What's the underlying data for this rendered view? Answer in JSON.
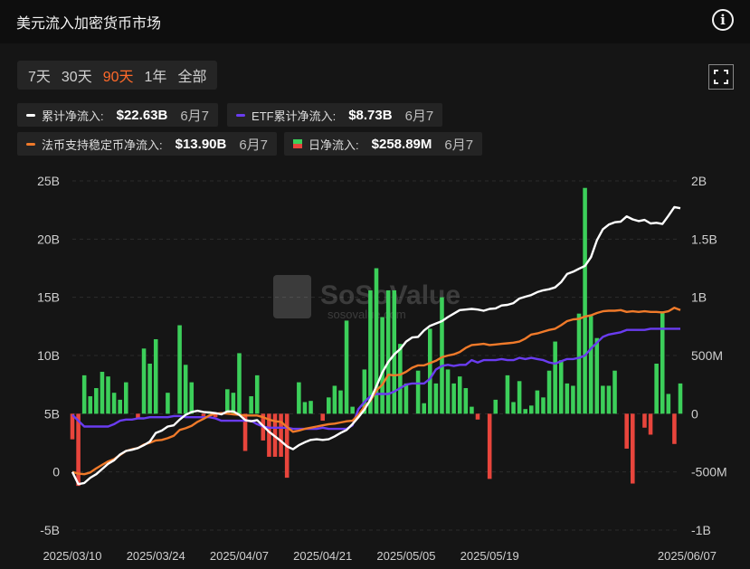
{
  "header": {
    "title": "美元流入加密货币市场"
  },
  "range_tabs": [
    "7天",
    "30天",
    "90天",
    "1年",
    "全部"
  ],
  "active_range": "90天",
  "legend": [
    {
      "label": "累计净流入:",
      "value": "$22.63B",
      "date": "6月7",
      "color": "#ffffff"
    },
    {
      "label": "ETF累计净流入:",
      "value": "$8.73B",
      "date": "6月7",
      "color": "#6a3cf0"
    },
    {
      "label": "法币支持稳定币净流入:",
      "value": "$13.90B",
      "date": "6月7",
      "color": "#f07a2a"
    },
    {
      "label": "日净流入:",
      "value": "$258.89M",
      "date": "6月7",
      "color_pos": "#3ccf5a",
      "color_neg": "#e8453c"
    }
  ],
  "watermark": {
    "brand": "SoSoValue",
    "sub": "sosovalue.com"
  },
  "chart_data": {
    "type": "bar+line",
    "x_tick_labels": [
      "2025/03/10",
      "2025/03/24",
      "2025/04/07",
      "2025/04/21",
      "2025/05/05",
      "2025/05/19",
      "2025/06/07"
    ],
    "left_axis": {
      "ticks": [
        "25B",
        "20B",
        "15B",
        "10B",
        "5B",
        "0",
        "-5B"
      ],
      "range": [
        -5,
        25
      ],
      "unit": "B"
    },
    "right_axis": {
      "ticks": [
        "2B",
        "1.5B",
        "1B",
        "500M",
        "0",
        "-500M",
        "-1B"
      ],
      "range": [
        -1,
        2
      ],
      "unit": "B"
    },
    "daily_net_inflow_B": [
      -0.22,
      -0.62,
      0.33,
      0.15,
      0.22,
      0.36,
      0.32,
      0.18,
      0.12,
      0.27,
      0,
      -0.04,
      0.56,
      0.43,
      0.64,
      0,
      0.18,
      0,
      0.76,
      0.42,
      0.27,
      0,
      -0.02,
      0.02,
      -0.03,
      0,
      0.21,
      0.18,
      0.52,
      -0.32,
      0.15,
      0.33,
      -0.23,
      -0.37,
      -0.37,
      -0.37,
      -0.55,
      0,
      0.27,
      0.1,
      0.11,
      0,
      -0.06,
      0.14,
      0.24,
      0.2,
      0.8,
      0.06,
      0,
      0.38,
      1.06,
      1.25,
      0.83,
      1.06,
      1.06,
      0.6,
      0.26,
      0,
      0.37,
      0.09,
      0.73,
      0.26,
      1,
      0.38,
      0.26,
      0.32,
      0.22,
      0.06,
      -0.05,
      0,
      -0.56,
      0.12,
      0,
      0.33,
      0.1,
      0.28,
      0.04,
      0.07,
      0.2,
      0.14,
      0.37,
      0.62,
      0.46,
      0.26,
      0.24,
      0.86,
      1.94,
      0.84,
      0.65,
      0.24,
      0.24,
      0.37,
      0,
      -0.3,
      -0.6,
      0,
      -0.12,
      -0.18,
      0.43,
      0.88,
      0.17,
      -0.26,
      0.26
    ],
    "series": [
      {
        "name": "累计净流入",
        "axis": "left",
        "values": [
          0,
          -1.05,
          -0.95,
          -0.5,
          -0.2,
          0.25,
          0.7,
          1,
          1.5,
          1.8,
          1.9,
          2.05,
          2.3,
          2.6,
          3.35,
          3.55,
          3.9,
          4,
          4.5,
          4.9,
          5.15,
          5.25,
          5.15,
          5.1,
          5.05,
          4.95,
          5.2,
          5.2,
          4.9,
          4.45,
          4.35,
          4.45,
          3.95,
          3.45,
          3.05,
          2.65,
          2.2,
          1.95,
          2.3,
          2.55,
          2.75,
          2.8,
          2.75,
          2.8,
          3.05,
          3.35,
          3.6,
          4.1,
          4.7,
          5.35,
          6.2,
          7.35,
          8.55,
          9.45,
          10.1,
          10.55,
          11.2,
          11.55,
          11.6,
          12.15,
          12.55,
          12.75,
          12.95,
          13.3,
          13.6,
          13.9,
          13.95,
          14,
          13.95,
          13.85,
          14,
          14.05,
          14.3,
          14.35,
          14.5,
          14.9,
          15.05,
          15.2,
          15.45,
          15.6,
          15.7,
          15.85,
          16.3,
          17,
          17.2,
          17.45,
          17.7,
          18.45,
          19.9,
          20.85,
          21.25,
          21.45,
          21.5,
          21.95,
          21.7,
          21.55,
          21.65,
          21.35,
          21.4,
          21.3,
          22,
          22.75,
          22.65
        ],
        "color": "#ffffff"
      },
      {
        "name": "ETF累计净流入",
        "axis": "right",
        "values": [
          -0.01,
          -0.06,
          -0.11,
          -0.11,
          -0.11,
          -0.11,
          -0.11,
          -0.09,
          -0.06,
          -0.05,
          -0.05,
          -0.04,
          -0.04,
          -0.03,
          -0.03,
          -0.03,
          -0.03,
          -0.02,
          -0.02,
          -0.03,
          -0.03,
          -0.03,
          -0.03,
          -0.03,
          -0.04,
          -0.06,
          -0.06,
          -0.06,
          -0.06,
          -0.06,
          -0.06,
          -0.09,
          -0.11,
          -0.12,
          -0.12,
          -0.12,
          -0.12,
          -0.13,
          -0.13,
          -0.13,
          -0.13,
          -0.13,
          -0.12,
          -0.13,
          -0.13,
          -0.13,
          -0.13,
          -0.1,
          0.04,
          0.1,
          0.15,
          0.17,
          0.17,
          0.17,
          0.19,
          0.22,
          0.25,
          0.26,
          0.26,
          0.26,
          0.3,
          0.38,
          0.41,
          0.42,
          0.41,
          0.42,
          0.42,
          0.46,
          0.44,
          0.46,
          0.46,
          0.46,
          0.47,
          0.46,
          0.46,
          0.48,
          0.47,
          0.48,
          0.47,
          0.46,
          0.44,
          0.43,
          0.45,
          0.47,
          0.47,
          0.48,
          0.5,
          0.56,
          0.61,
          0.66,
          0.68,
          0.69,
          0.7,
          0.72,
          0.72,
          0.72,
          0.72,
          0.73,
          0.73,
          0.73,
          0.73,
          0.73,
          0.73
        ],
        "color": "#6a3cf0"
      },
      {
        "name": "法币支持稳定币净流入",
        "axis": "left",
        "values": [
          0,
          -0.15,
          -0.2,
          -0.05,
          0.3,
          0.6,
          0.9,
          1.1,
          1.45,
          1.8,
          1.95,
          2.05,
          2.35,
          2.5,
          2.7,
          2.75,
          2.9,
          3.1,
          3.6,
          3.75,
          3.95,
          4.3,
          4.55,
          4.85,
          5,
          5.05,
          5,
          4.95,
          4.9,
          4.85,
          4.85,
          4.85,
          4.7,
          4.5,
          4.35,
          4.3,
          3.85,
          3.45,
          3.55,
          3.7,
          3.8,
          3.9,
          4,
          4.1,
          4.15,
          4.25,
          4.35,
          4.4,
          4.9,
          5.6,
          6.1,
          7,
          7.5,
          8.35,
          8.3,
          8.35,
          8.6,
          8.95,
          9.15,
          9.15,
          9.35,
          9.55,
          9.85,
          10,
          10.1,
          10.3,
          10.65,
          10.9,
          10.95,
          11,
          10.9,
          10.95,
          11,
          11.05,
          11.1,
          11.2,
          11.45,
          11.8,
          11.9,
          12.05,
          12.2,
          12.3,
          12.6,
          12.95,
          13.1,
          13.15,
          13.35,
          13.45,
          13.65,
          13.8,
          13.85,
          13.85,
          13.9,
          13.75,
          13.8,
          13.75,
          13.8,
          13.75,
          13.75,
          13.7,
          13.8,
          14.1,
          13.9
        ],
        "color": "#f07a2a"
      }
    ]
  }
}
